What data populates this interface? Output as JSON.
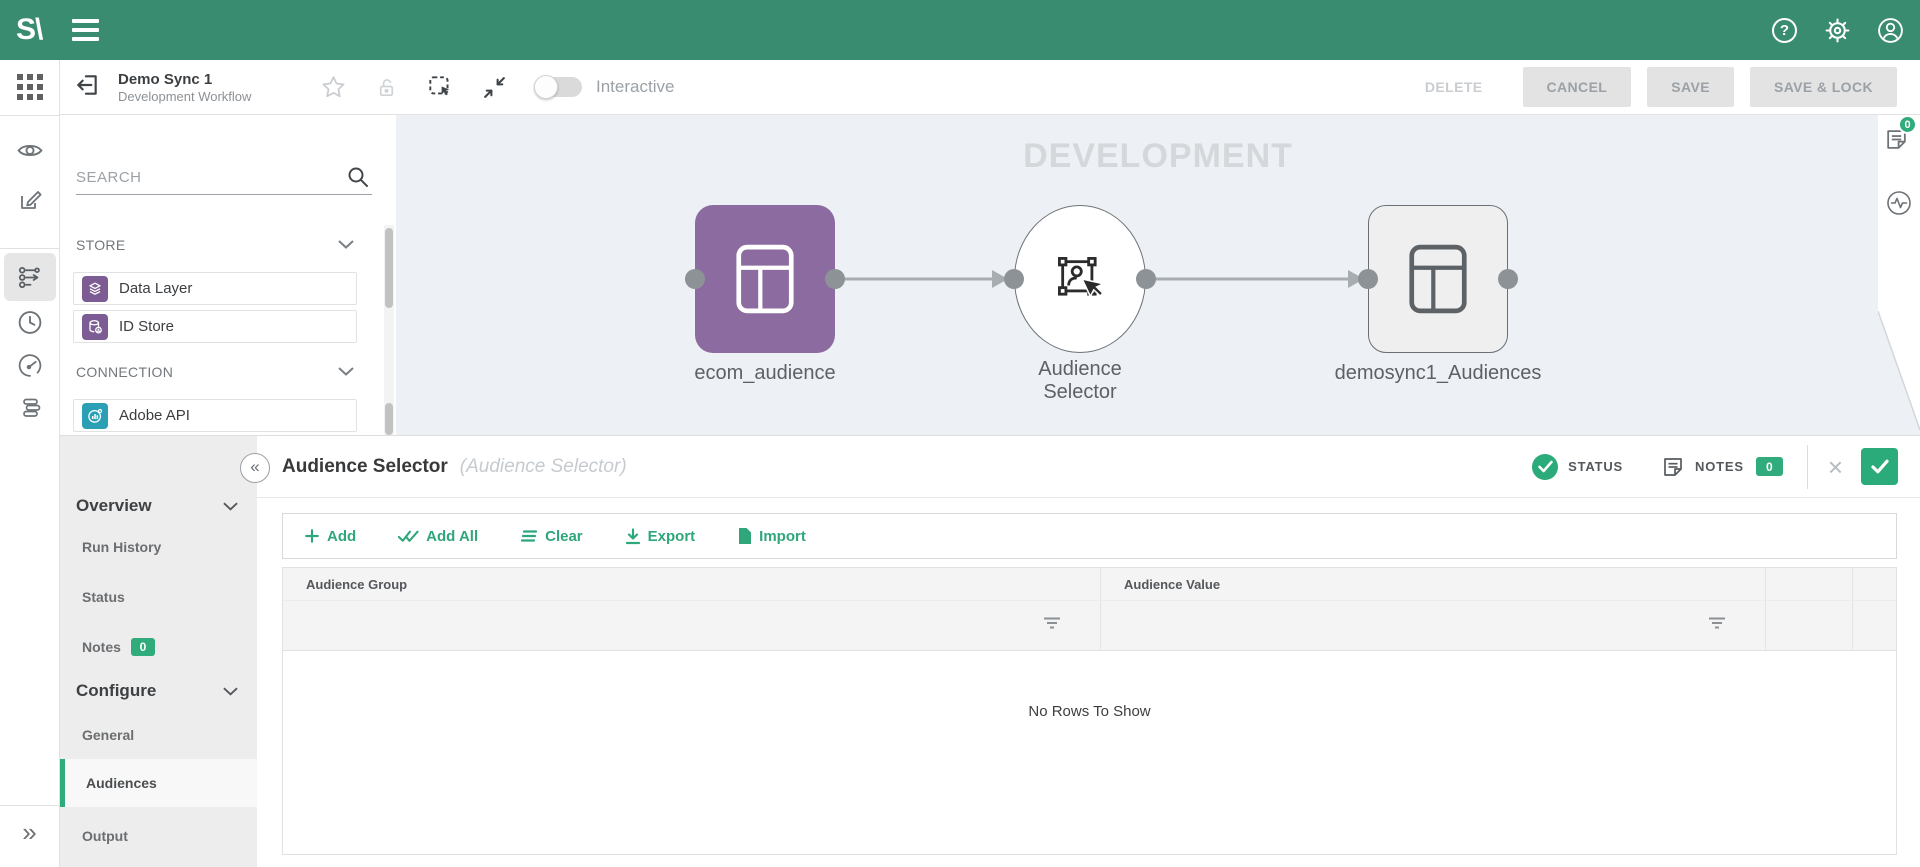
{
  "app": {
    "logo_text": "S\\"
  },
  "icons": {
    "question": "?",
    "collapse_left": "«",
    "expand_right": "»",
    "close": "×"
  },
  "colors": {
    "topbar_green": "#3a8c70",
    "accent_green": "#2fab7c",
    "node_purple": "#8c6ba0",
    "canvas_bg": "#edf1f5"
  },
  "toolbar": {
    "title": "Demo Sync 1",
    "subtitle": "Development Workflow",
    "interactive_label": "Interactive",
    "delete_label": "DELETE",
    "cancel_label": "CANCEL",
    "save_label": "SAVE",
    "save_lock_label": "SAVE & LOCK"
  },
  "palette": {
    "search_placeholder": "SEARCH",
    "store_header": "STORE",
    "store_items": [
      {
        "label": "Data Layer"
      },
      {
        "label": "ID Store"
      }
    ],
    "connection_header": "CONNECTION",
    "connection_items": [
      {
        "label": "Adobe API"
      }
    ]
  },
  "canvas": {
    "watermark": "DEVELOPMENT",
    "side_badge_count": "0",
    "nodes": [
      {
        "label": "ecom_audience"
      },
      {
        "label_line1": "Audience",
        "label_line2": "Selector"
      },
      {
        "label": "demosync1_Audiences"
      }
    ]
  },
  "inspector": {
    "title": "Audience Selector",
    "subtitle": "(Audience Selector)",
    "status_label": "STATUS",
    "notes_label": "NOTES",
    "notes_count": "0",
    "nav": {
      "overview": {
        "label": "Overview",
        "items": [
          {
            "label": "Run History"
          },
          {
            "label": "Status"
          },
          {
            "label": "Notes",
            "badge": "0"
          }
        ]
      },
      "configure": {
        "label": "Configure",
        "items": [
          {
            "label": "General"
          },
          {
            "label": "Audiences"
          },
          {
            "label": "Output"
          }
        ]
      }
    },
    "actions": [
      {
        "label": "Add"
      },
      {
        "label": "Add All"
      },
      {
        "label": "Clear"
      },
      {
        "label": "Export"
      },
      {
        "label": "Import"
      }
    ],
    "table": {
      "columns": [
        {
          "label": "Audience Group"
        },
        {
          "label": "Audience Value"
        }
      ],
      "empty_text": "No Rows To Show"
    }
  }
}
